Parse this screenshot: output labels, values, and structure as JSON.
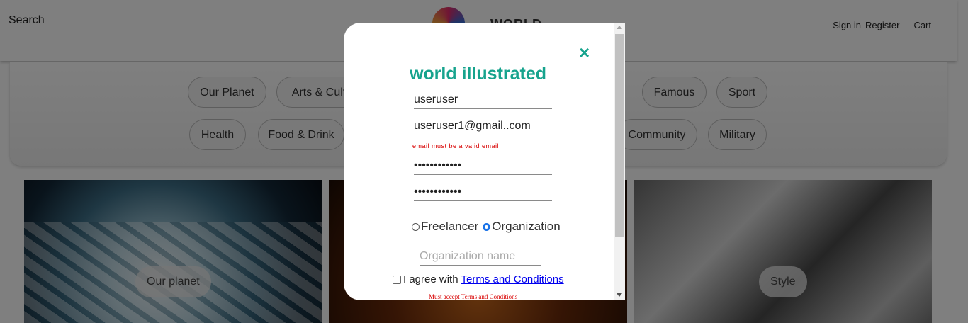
{
  "header": {
    "search_label": "Search",
    "sign_in": "Sign in",
    "register": "Register",
    "cart": "Cart"
  },
  "categories": {
    "row1": [
      "Our Planet",
      "Arts & Cult",
      "Famous",
      "Sport"
    ],
    "row2": [
      "Health",
      "Food & Drink",
      "Community",
      "Military"
    ]
  },
  "cards": [
    {
      "label": "Our planet"
    },
    {
      "label": ""
    },
    {
      "label": "Style"
    }
  ],
  "modal": {
    "close_icon": "×",
    "brand": "world illustrated",
    "username_value": "useruser",
    "email_value": "useruser1@gmail..com",
    "email_error": "email must be a valid email",
    "password_value": "••••••••••••",
    "confirm_password_value": "••••••••••••",
    "role_options": [
      "Freelancer",
      "Organization"
    ],
    "role_selected": "Organization",
    "org_name_placeholder": "Organization name",
    "terms_prefix": "I agree with",
    "terms_link": "Terms and Conditions",
    "terms_error": "Must accept Terms and Conditions"
  },
  "colors": {
    "accent": "#16a38d",
    "error": "#d80000",
    "link": "#0000ee"
  }
}
